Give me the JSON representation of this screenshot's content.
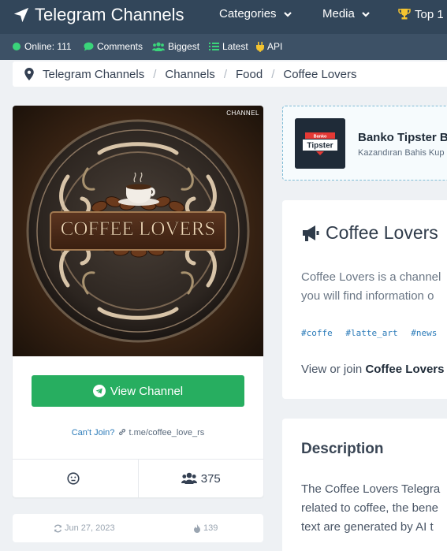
{
  "nav": {
    "brand": "Telegram Channels",
    "items": [
      "Categories",
      "Media",
      "Top 1"
    ]
  },
  "subnav": {
    "online": "Online: 111",
    "comments": "Comments",
    "biggest": "Biggest",
    "latest": "Latest",
    "api": "API"
  },
  "breadcrumb": [
    "Telegram Channels",
    "Channels",
    "Food",
    "Coffee Lovers"
  ],
  "channel": {
    "badge": "CHANNEL",
    "cover_text": "COFFEE LOVERS",
    "view_button": "View Channel",
    "cant_join": "Can't Join?",
    "link": "t.me/coffee_love_rs",
    "subscribers": "375",
    "date": "Jun 27, 2023",
    "views": "139"
  },
  "ad": {
    "logo_top": "Banko",
    "logo_main": "Tipster",
    "title": "Banko Tipster B",
    "subtitle": "Kazandıran Bahis Kup"
  },
  "info": {
    "title": "Coffee Lovers",
    "text_line1": "Coffee Lovers is a channel",
    "text_line2": "you will find information o",
    "tags": [
      "#coffe",
      "#latte_art",
      "#news",
      "#"
    ],
    "join_prefix": "View or join ",
    "join_name": "Coffee Lovers"
  },
  "description": {
    "title": "Description",
    "line1": "The Coffee Lovers Telegra",
    "line2": "related to coffee, the bene",
    "line3": "text are generated by AI t"
  },
  "colors": {
    "nav_bg": "#32465a",
    "subnav_bg": "#3d5166",
    "accent_green": "#27ae60",
    "link_blue": "#2b7bb9"
  }
}
